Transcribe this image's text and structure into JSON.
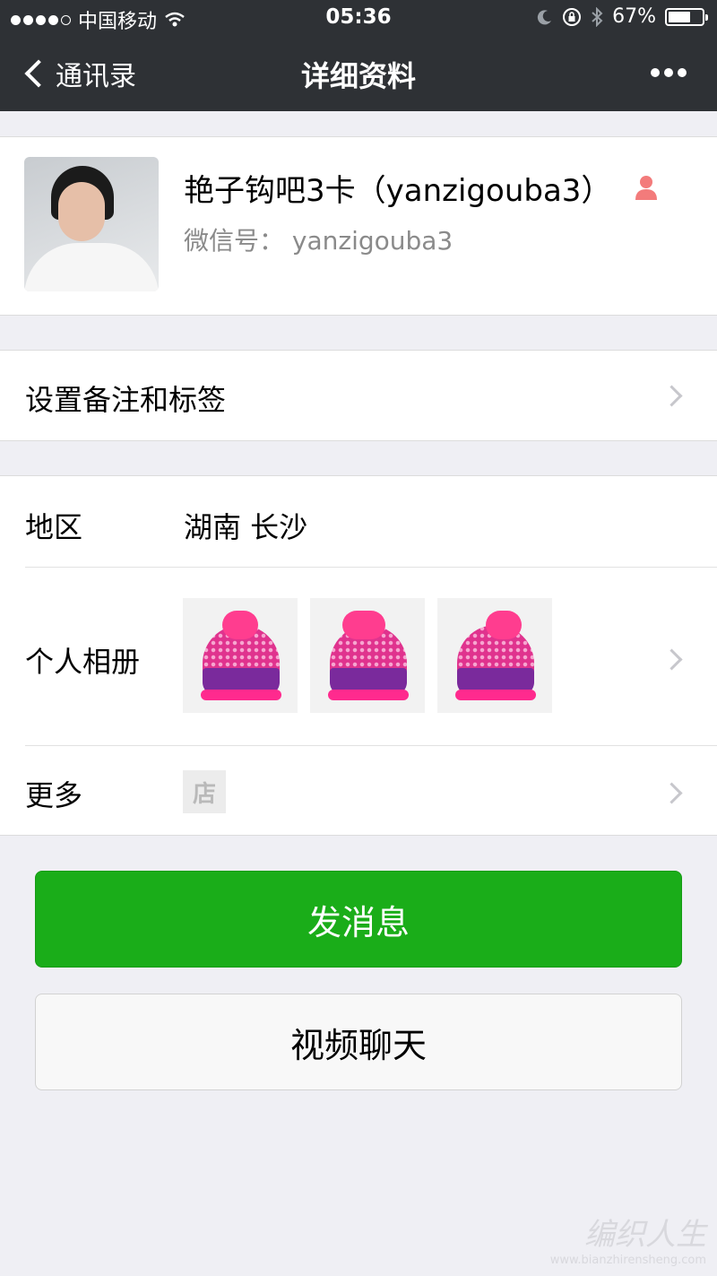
{
  "status_bar": {
    "carrier": "中国移动",
    "time": "05:36",
    "battery_text": "67%",
    "battery_level": 0.67
  },
  "nav": {
    "back_label": "通讯录",
    "title": "详细资料"
  },
  "profile": {
    "name": "艳子钩吧3卡（yanzigouba3）",
    "wechat_id": "微信号： yanzigouba3"
  },
  "remark_row": {
    "label": "设置备注和标签"
  },
  "info": {
    "region_label": "地区",
    "region_value": "湖南 长沙",
    "album_label": "个人相册",
    "more_label": "更多",
    "shop_icon_text": "店"
  },
  "buttons": {
    "send_message": "发消息",
    "video_call": "视频聊天"
  },
  "watermark": {
    "brand": "编织人生",
    "url": "www.bianzhirensheng.com"
  },
  "colors": {
    "topbar": "#2e3135",
    "primary_green": "#1aad19",
    "background": "#efeff4",
    "gender_icon": "#f37b7b"
  }
}
